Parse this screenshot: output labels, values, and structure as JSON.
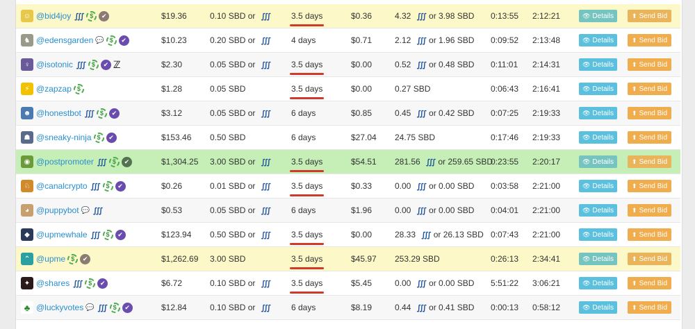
{
  "buttons": {
    "details": "Details",
    "send_bid": "Send Bid"
  },
  "rows": [
    {
      "bot": "@bid4joy",
      "avatar_color": "#e8c84a",
      "avatar_glyph": "☺",
      "icons": [
        "steem-icon",
        "dollar-icon",
        "verified-icon-muted"
      ],
      "value": "$19.36",
      "min_bid": "0.10 SBD or ",
      "min_bid_steem": true,
      "max_age": "3.5 days",
      "underline": true,
      "vote_value": "$0.36",
      "max_bid": "4.32 ",
      "max_bid_rest": " or 3.98 SBD",
      "max_bid_steem": true,
      "next_vote": "0:13:55",
      "round_time": "2:12:21",
      "style": "yellow"
    },
    {
      "bot": "@edensgarden",
      "avatar_color": "#9a9a8a",
      "avatar_glyph": "♞",
      "icons": [
        "chat-icon",
        "dollar-icon",
        "verified-icon"
      ],
      "value": "$10.23",
      "min_bid": "0.20 SBD or ",
      "min_bid_steem": true,
      "max_age": "4 days",
      "underline": false,
      "vote_value": "$0.71",
      "max_bid": "2.12 ",
      "max_bid_rest": " or 1.96 SBD",
      "max_bid_steem": true,
      "next_vote": "0:09:52",
      "round_time": "2:13:48",
      "style": "white"
    },
    {
      "bot": "@isotonic",
      "avatar_color": "#6a5a9a",
      "avatar_glyph": "♀",
      "icons": [
        "steem-icon",
        "dollar-icon",
        "verified-icon",
        "swoosh-icon"
      ],
      "value": "$2.30",
      "min_bid": "0.05 SBD or ",
      "min_bid_steem": true,
      "max_age": "3.5 days",
      "underline": true,
      "vote_value": "$0.00",
      "max_bid": "0.52 ",
      "max_bid_rest": " or 0.48 SBD",
      "max_bid_steem": true,
      "next_vote": "0:11:01",
      "round_time": "2:14:31",
      "style": "stripe"
    },
    {
      "bot": "@zapzap",
      "avatar_color": "#f2c200",
      "avatar_glyph": "⚡",
      "icons": [
        "dollar-icon"
      ],
      "value": "$1.28",
      "min_bid": "0.05 SBD",
      "min_bid_steem": false,
      "max_age": "3.5 days",
      "underline": true,
      "vote_value": "$0.00",
      "max_bid": "0.27 SBD",
      "max_bid_rest": "",
      "max_bid_steem": false,
      "next_vote": "0:06:43",
      "round_time": "2:16:41",
      "style": "white"
    },
    {
      "bot": "@honestbot",
      "avatar_color": "#4a7ab0",
      "avatar_glyph": "☻",
      "icons": [
        "steem-icon",
        "dollar-icon",
        "verified-icon"
      ],
      "value": "$3.12",
      "min_bid": "0.05 SBD or ",
      "min_bid_steem": true,
      "max_age": "6 days",
      "underline": false,
      "vote_value": "$0.85",
      "max_bid": "0.45 ",
      "max_bid_rest": " or 0.42 SBD",
      "max_bid_steem": true,
      "next_vote": "0:07:25",
      "round_time": "2:19:33",
      "style": "stripe"
    },
    {
      "bot": "@sneaky-ninja",
      "avatar_color": "#5a6a8a",
      "avatar_glyph": "☗",
      "icons": [
        "dollar-icon",
        "verified-icon"
      ],
      "value": "$153.46",
      "min_bid": "0.50 SBD",
      "min_bid_steem": false,
      "max_age": "6 days",
      "underline": false,
      "vote_value": "$27.04",
      "max_bid": "24.75 SBD",
      "max_bid_rest": "",
      "max_bid_steem": false,
      "next_vote": "0:17:46",
      "round_time": "2:19:33",
      "style": "white"
    },
    {
      "bot": "@postpromoter",
      "avatar_color": "#6a9a3a",
      "avatar_glyph": "◉",
      "icons": [
        "steem-icon",
        "dollar-icon",
        "verified-icon-green"
      ],
      "value": "$1,304.25",
      "min_bid": "3.00 SBD or ",
      "min_bid_steem": true,
      "max_age": "3.5 days",
      "underline": true,
      "vote_value": "$54.51",
      "max_bid": "281.56 ",
      "max_bid_rest": " or 259.65 SBD",
      "max_bid_steem": true,
      "next_vote": "0:23:55",
      "round_time": "2:20:17",
      "style": "green"
    },
    {
      "bot": "@canalcrypto",
      "avatar_color": "#d08a2a",
      "avatar_glyph": "♘",
      "icons": [
        "steem-icon",
        "dollar-icon",
        "verified-icon"
      ],
      "value": "$0.26",
      "min_bid": "0.01 SBD or ",
      "min_bid_steem": true,
      "max_age": "3.5 days",
      "underline": true,
      "vote_value": "$0.33",
      "max_bid": "0.00 ",
      "max_bid_rest": " or 0.00 SBD",
      "max_bid_steem": true,
      "next_vote": "0:03:58",
      "round_time": "2:21:00",
      "style": "white"
    },
    {
      "bot": "@puppybot",
      "avatar_color": "#c8a070",
      "avatar_glyph": "◕",
      "icons": [
        "chat-icon",
        "steem-icon"
      ],
      "value": "$0.53",
      "min_bid": "0.05 SBD or ",
      "min_bid_steem": true,
      "max_age": "6 days",
      "underline": false,
      "vote_value": "$1.96",
      "max_bid": "0.00 ",
      "max_bid_rest": " or 0.00 SBD",
      "max_bid_steem": true,
      "next_vote": "0:04:01",
      "round_time": "2:21:00",
      "style": "stripe"
    },
    {
      "bot": "@upmewhale",
      "avatar_color": "#2a3a5a",
      "avatar_glyph": "◆",
      "icons": [
        "steem-icon",
        "dollar-icon",
        "verified-icon"
      ],
      "value": "$123.94",
      "min_bid": "0.50 SBD or ",
      "min_bid_steem": true,
      "max_age": "3.5 days",
      "underline": true,
      "vote_value": "$0.00",
      "max_bid": "28.33 ",
      "max_bid_rest": " or 26.13 SBD",
      "max_bid_steem": true,
      "next_vote": "0:07:43",
      "round_time": "2:21:00",
      "style": "white"
    },
    {
      "bot": "@upme",
      "avatar_color": "#2aa0a0",
      "avatar_glyph": "⌃",
      "icons": [
        "dollar-icon",
        "verified-icon-muted"
      ],
      "value": "$1,262.69",
      "min_bid": "3.00 SBD",
      "min_bid_steem": false,
      "max_age": "3.5 days",
      "underline": true,
      "vote_value": "$45.97",
      "max_bid": "253.29 SBD",
      "max_bid_rest": "",
      "max_bid_steem": false,
      "next_vote": "0:26:13",
      "round_time": "2:34:41",
      "style": "yellow"
    },
    {
      "bot": "@shares",
      "avatar_color": "#2a1a1a",
      "avatar_glyph": "✦",
      "icons": [
        "steem-icon",
        "dollar-icon",
        "verified-icon"
      ],
      "value": "$6.72",
      "min_bid": "0.10 SBD or ",
      "min_bid_steem": true,
      "max_age": "3.5 days",
      "underline": true,
      "vote_value": "$5.45",
      "max_bid": "0.00 ",
      "max_bid_rest": " or 0.00 SBD",
      "max_bid_steem": true,
      "next_vote": "5:51:22",
      "round_time": "3:06:21",
      "style": "white"
    },
    {
      "bot": "@luckyvotes",
      "avatar_color": "#ffffff",
      "avatar_glyph": "♣",
      "icons": [
        "chat-icon",
        "steem-icon",
        "dollar-icon",
        "verified-icon"
      ],
      "value": "$12.84",
      "min_bid": "0.10 SBD or ",
      "min_bid_steem": true,
      "max_age": "6 days",
      "underline": false,
      "vote_value": "$8.19",
      "max_bid": "0.44 ",
      "max_bid_rest": " or 0.41 SBD",
      "max_bid_steem": true,
      "next_vote": "0:00:13",
      "round_time": "0:58:12",
      "style": "stripe"
    }
  ]
}
